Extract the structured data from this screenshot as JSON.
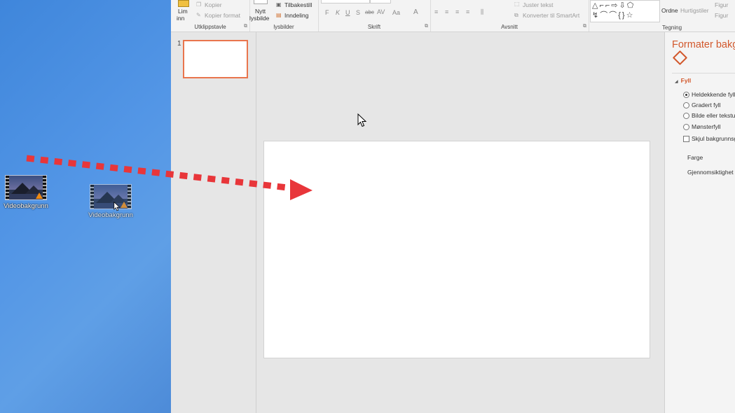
{
  "desktop": {
    "files": [
      {
        "label": "Videobakgrunn"
      },
      {
        "label": "Videobakgrunn"
      }
    ]
  },
  "ribbon": {
    "clipboard": {
      "paste_label_1": "Lim",
      "paste_label_2": "inn",
      "copy": "Kopier",
      "copy_format": "Kopier format",
      "group": "Utklippstavle"
    },
    "slides": {
      "new_slide_1": "Nytt",
      "new_slide_2": "lysbilde",
      "reset": "Tilbakestill",
      "section": "Inndeling",
      "group": "lysbilder"
    },
    "font": {
      "bold": "F",
      "italic": "K",
      "underline": "U",
      "shadow": "S",
      "strike": "abc",
      "spacing": "AV",
      "case": "Aa",
      "color": "A",
      "group": "Skrift"
    },
    "paragraph": {
      "align_text": "Juster tekst",
      "smartart": "Konverter til SmartArt",
      "group": "Avsnitt"
    },
    "drawing": {
      "arrange": "Ordne",
      "quick_styles": "Hurtigstiler",
      "shape_fill": "Figur",
      "shape_outline": "Figur",
      "group": "Tegning"
    }
  },
  "thumbnails": {
    "slide_number": "1"
  },
  "format_pane": {
    "title": "Formater bakgrunn",
    "section": "Fyll",
    "options": [
      {
        "label": "Heldekkende fyll",
        "selected": true
      },
      {
        "label": "Gradert fyll",
        "selected": false
      },
      {
        "label": "Bilde eller tekstur",
        "selected": false
      },
      {
        "label": "Mønsterfyll",
        "selected": false
      }
    ],
    "hide_graphics": "Skjul bakgrunnsgrafikk",
    "color_label": "Farge",
    "transparency_label": "Gjennomsiktighet"
  },
  "colors": {
    "accent": "#d2582c",
    "annotation_arrow": "#e8363a",
    "desktop": "#4f8fd9"
  }
}
